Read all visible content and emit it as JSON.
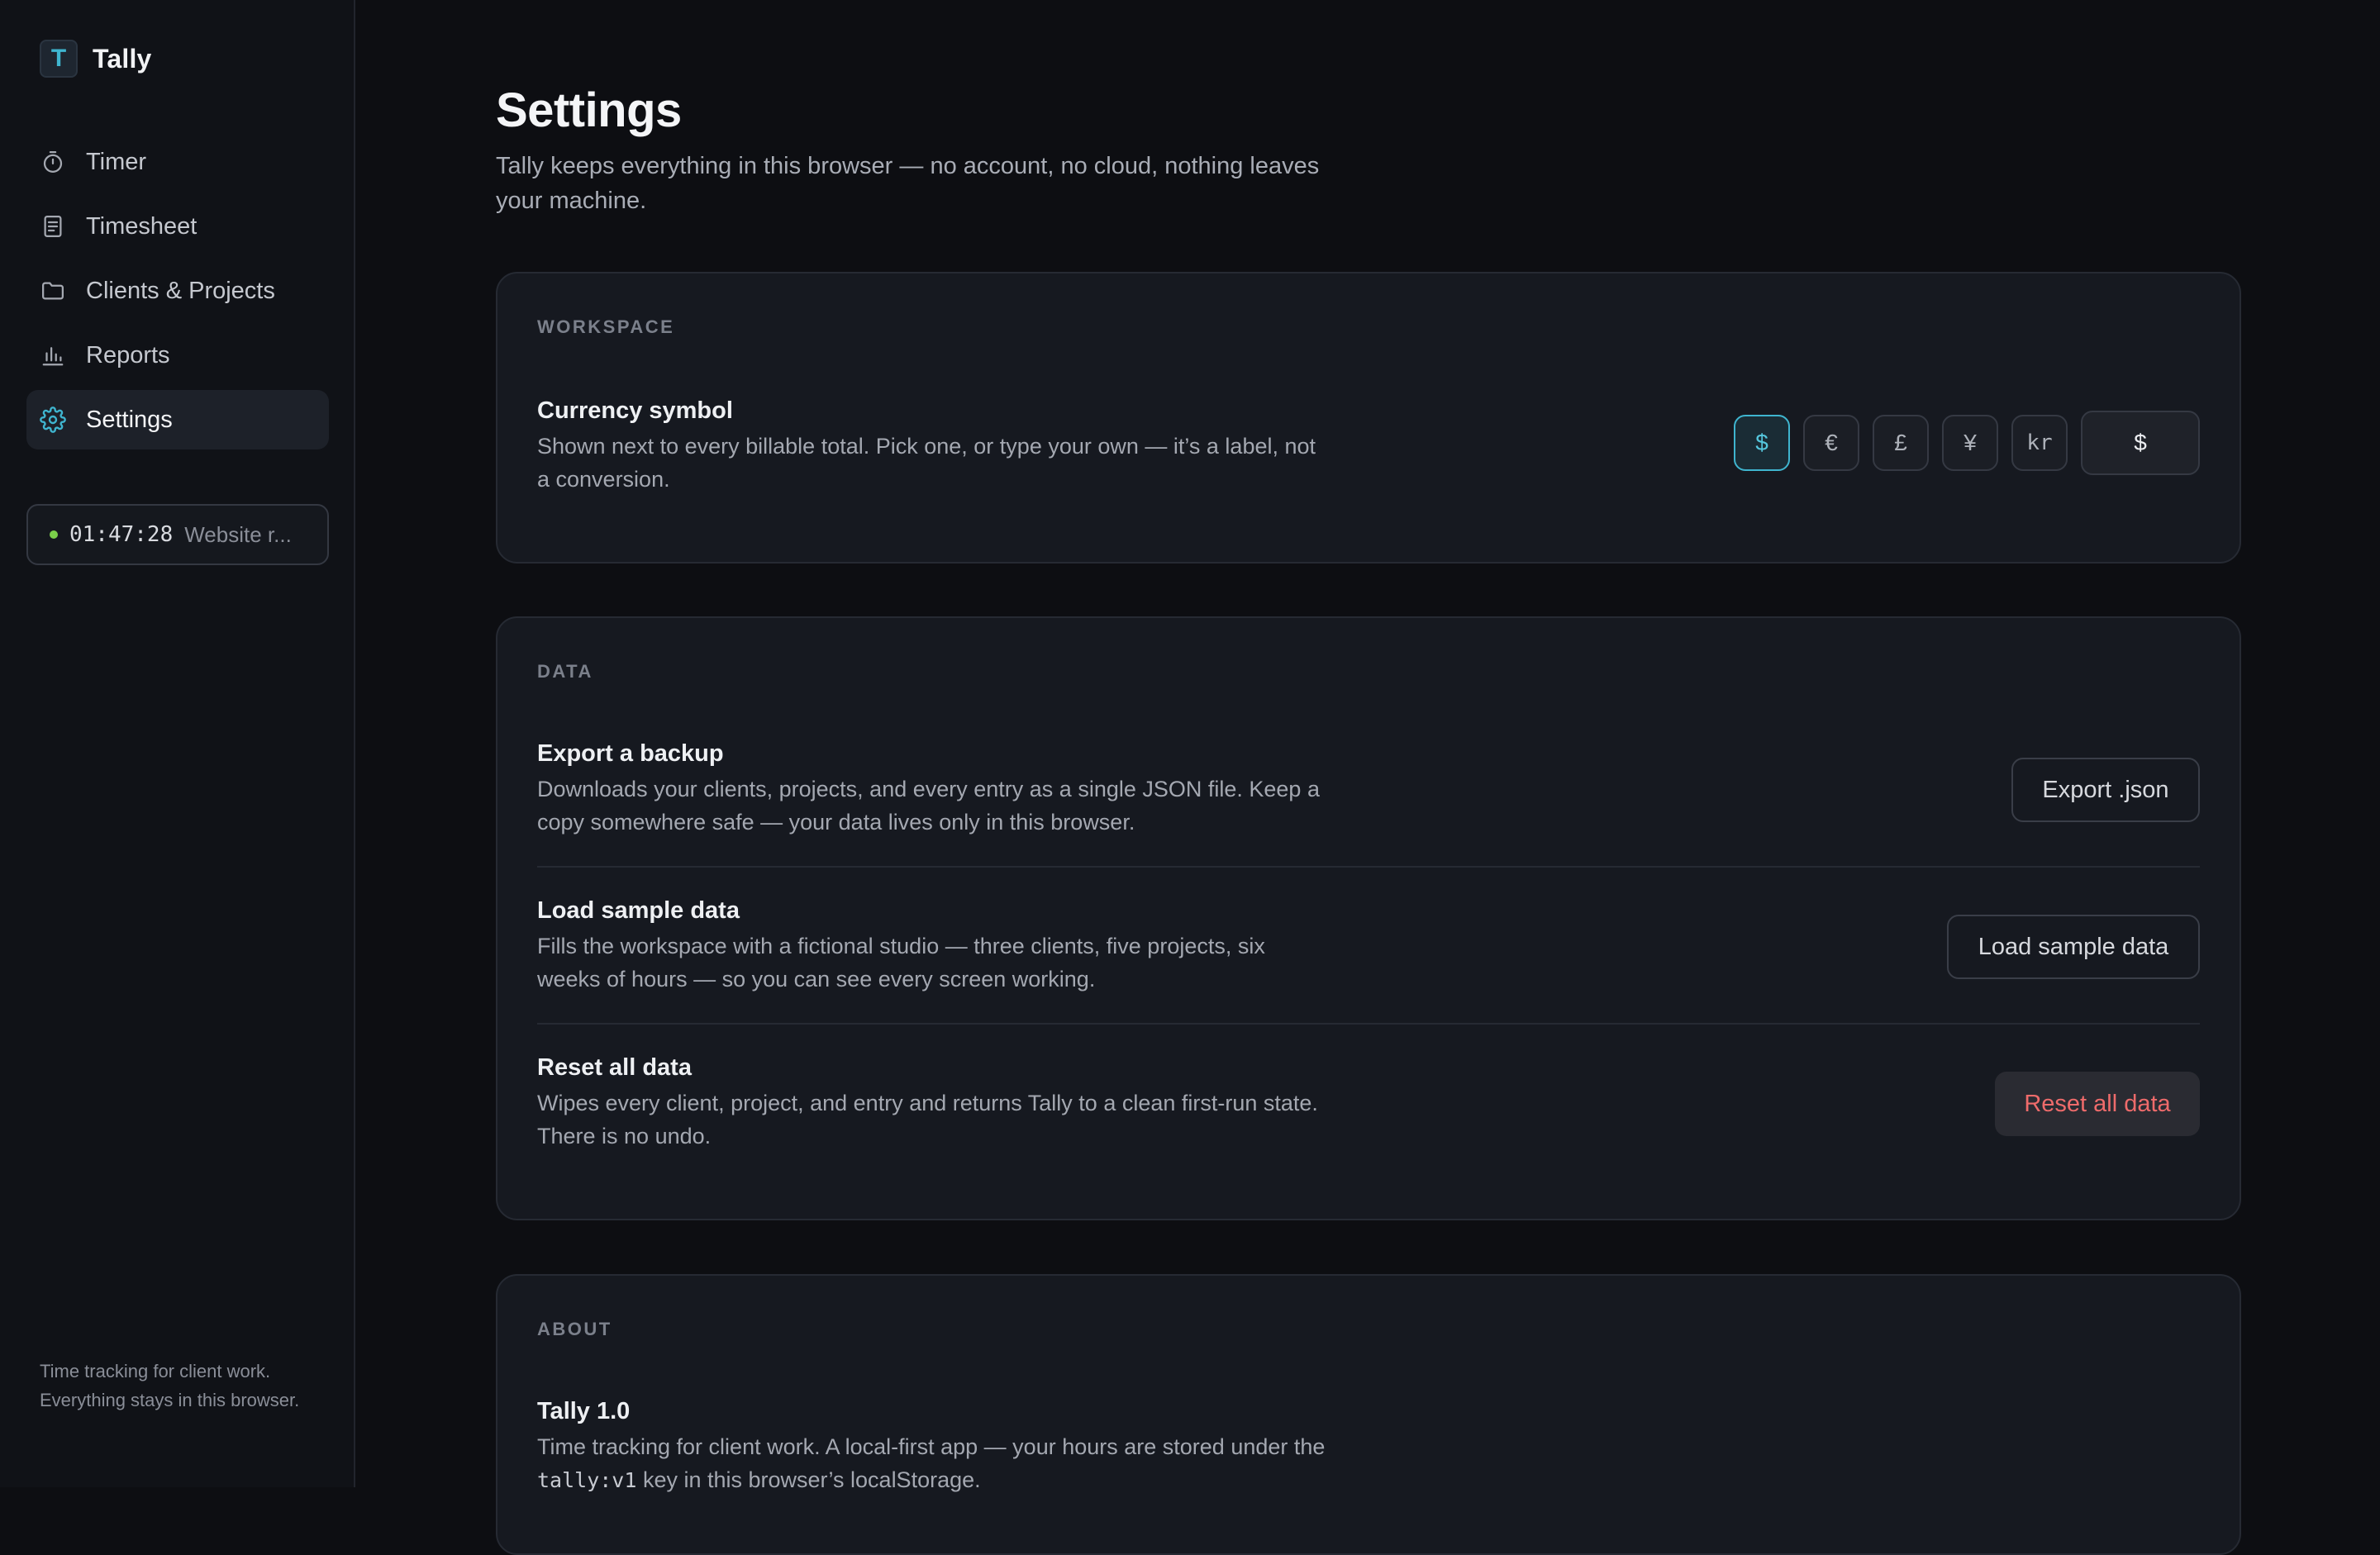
{
  "app": {
    "name": "Tally",
    "logo_letter": "T",
    "accent": "#3fb5cf"
  },
  "sidebar": {
    "items": [
      {
        "label": "Timer",
        "icon": "stopwatch-icon",
        "active": false
      },
      {
        "label": "Timesheet",
        "icon": "document-icon",
        "active": false
      },
      {
        "label": "Clients & Projects",
        "icon": "folder-icon",
        "active": false
      },
      {
        "label": "Reports",
        "icon": "bar-chart-icon",
        "active": false
      },
      {
        "label": "Settings",
        "icon": "gear-icon",
        "active": true
      }
    ],
    "running_timer": {
      "time": "01:47:28",
      "label": "Website r...",
      "status_color": "#7bd04a"
    },
    "footer": "Time tracking for client work. Everything stays in this browser."
  },
  "page": {
    "title": "Settings",
    "subtitle": "Tally keeps everything in this browser — no account, no cloud, nothing leaves your machine."
  },
  "workspace": {
    "label": "WORKSPACE",
    "currency": {
      "title": "Currency symbol",
      "description": "Shown next to every billable total. Pick one, or type your own — it’s a label, not a conversion.",
      "options": [
        "$",
        "€",
        "£",
        "¥",
        "kr"
      ],
      "selected": "$",
      "custom_value": "$"
    }
  },
  "data": {
    "label": "DATA",
    "export": {
      "title": "Export a backup",
      "description": "Downloads your clients, projects, and every entry as a single JSON file. Keep a copy somewhere safe — your data lives only in this browser.",
      "button": "Export .json"
    },
    "sample": {
      "title": "Load sample data",
      "description": "Fills the workspace with a fictional studio — three clients, five projects, six weeks of hours — so you can see every screen working.",
      "button": "Load sample data"
    },
    "reset": {
      "title": "Reset all data",
      "description": "Wipes every client, project, and entry and returns Tally to a clean first-run state. There is no undo.",
      "button": "Reset all data",
      "danger_color": "#ee6b6b"
    }
  },
  "about": {
    "label": "ABOUT",
    "title": "Tally 1.0",
    "desc_before": "Time tracking for client work. A local-first app — your hours are stored under the",
    "storage_key": "tally:v1",
    "desc_after": "key in this browser’s localStorage."
  }
}
